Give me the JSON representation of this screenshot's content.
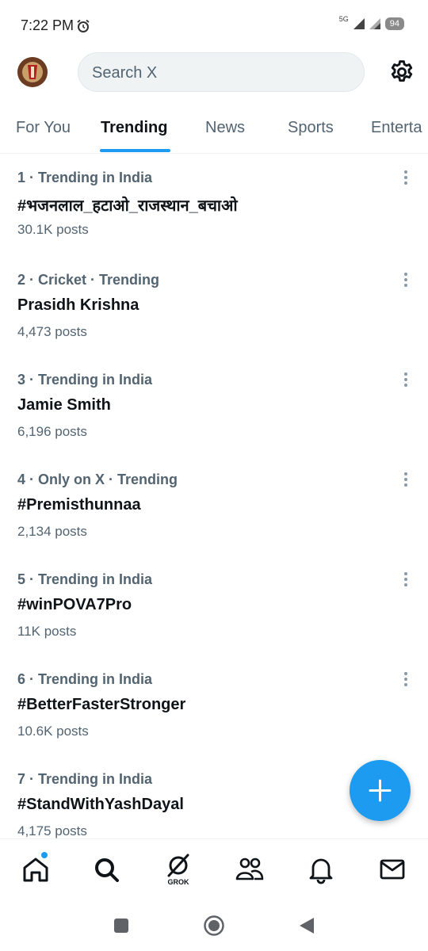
{
  "status_bar": {
    "time": "7:22 PM",
    "network": "5G",
    "battery": "94"
  },
  "header": {
    "search_placeholder": "Search X"
  },
  "tabs": [
    {
      "label": "For You"
    },
    {
      "label": "Trending"
    },
    {
      "label": "News"
    },
    {
      "label": "Sports"
    },
    {
      "label": "Enterta"
    }
  ],
  "active_tab": "Trending",
  "trends": [
    {
      "meta": "1 · Trending in India",
      "name": "#भजनलाल_हटाओ_राजस्थान_बचाओ",
      "posts": "30.1K posts"
    },
    {
      "meta": "2 · Cricket · Trending",
      "name": "Prasidh Krishna",
      "posts": "4,473 posts"
    },
    {
      "meta": "3 · Trending in India",
      "name": "Jamie Smith",
      "posts": "6,196 posts"
    },
    {
      "meta": "4 · Only on X · Trending",
      "name": "#Premisthunnaa",
      "posts": "2,134 posts"
    },
    {
      "meta": "5 · Trending in India",
      "name": "#winPOVA7Pro",
      "posts": "11K posts"
    },
    {
      "meta": "6 · Trending in India",
      "name": "#BetterFasterStronger",
      "posts": "10.6K posts"
    },
    {
      "meta": "7 · Trending in India",
      "name": "#StandWithYashDayal",
      "posts": "4,175 posts"
    }
  ],
  "bottom_nav": {
    "grok_label": "GROK",
    "icons": [
      "home-icon",
      "search-icon",
      "grok-icon",
      "communities-icon",
      "notifications-icon",
      "messages-icon"
    ]
  },
  "colors": {
    "accent": "#1d9bf0",
    "text_primary": "#0f1419",
    "text_secondary": "#536471"
  }
}
